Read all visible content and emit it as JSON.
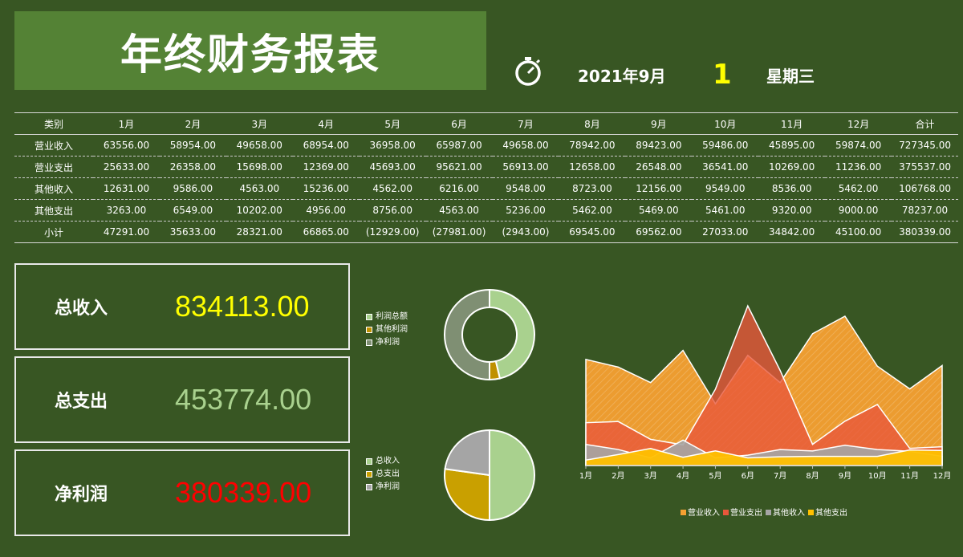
{
  "header": {
    "title": "年终财务报表",
    "date": "2021年9月",
    "day": "1",
    "weekday": "星期三"
  },
  "table": {
    "columns": [
      "类别",
      "1月",
      "2月",
      "3月",
      "4月",
      "5月",
      "6月",
      "7月",
      "8月",
      "9月",
      "10月",
      "11月",
      "12月",
      "合计"
    ],
    "rows": [
      {
        "label": "营业收入",
        "values": [
          "63556.00",
          "58954.00",
          "49658.00",
          "68954.00",
          "36958.00",
          "65987.00",
          "49658.00",
          "78942.00",
          "89423.00",
          "59486.00",
          "45895.00",
          "59874.00",
          "727345.00"
        ]
      },
      {
        "label": "营业支出",
        "values": [
          "25633.00",
          "26358.00",
          "15698.00",
          "12369.00",
          "45693.00",
          "95621.00",
          "56913.00",
          "12658.00",
          "26548.00",
          "36541.00",
          "10269.00",
          "11236.00",
          "375537.00"
        ]
      },
      {
        "label": "其他收入",
        "values": [
          "12631.00",
          "9586.00",
          "4563.00",
          "15236.00",
          "4562.00",
          "6216.00",
          "9548.00",
          "8723.00",
          "12156.00",
          "9549.00",
          "8536.00",
          "5462.00",
          "106768.00"
        ]
      },
      {
        "label": "其他支出",
        "values": [
          "3263.00",
          "6549.00",
          "10202.00",
          "4956.00",
          "8756.00",
          "4563.00",
          "5236.00",
          "5462.00",
          "5469.00",
          "5461.00",
          "9320.00",
          "9000.00",
          "78237.00"
        ]
      },
      {
        "label": "小计",
        "values": [
          "47291.00",
          "35633.00",
          "28321.00",
          "66865.00",
          "(12929.00)",
          "(27981.00)",
          "(2943.00)",
          "69545.00",
          "69562.00",
          "27033.00",
          "34842.00",
          "45100.00",
          "380339.00"
        ]
      }
    ]
  },
  "kpis": [
    {
      "label": "总收入",
      "value": "834113.00",
      "color": "#ffff00"
    },
    {
      "label": "总支出",
      "value": "453774.00",
      "color": "#a9d18e"
    },
    {
      "label": "净利润",
      "value": "380339.00",
      "color": "#ff0000"
    }
  ],
  "chart_data": [
    {
      "type": "pie",
      "variant": "donut",
      "labels": [
        "利润总额",
        "其他利润",
        "净利润"
      ],
      "values": [
        352234,
        28105,
        380339
      ],
      "colors": [
        "#a9d18e",
        "#bf9000",
        "#7f8f73"
      ]
    },
    {
      "type": "pie",
      "labels": [
        "总收入",
        "总支出",
        "净利润"
      ],
      "values": [
        834113,
        453774,
        380339
      ],
      "colors": [
        "#a9d18e",
        "#c9a000",
        "#a5a5a5"
      ]
    },
    {
      "type": "area",
      "categories": [
        "1月",
        "2月",
        "3月",
        "4月",
        "5月",
        "6月",
        "7月",
        "8月",
        "9月",
        "10月",
        "11月",
        "12月"
      ],
      "series": [
        {
          "name": "营业收入",
          "values": [
            63556,
            58954,
            49658,
            68954,
            36958,
            65987,
            49658,
            78942,
            89423,
            59486,
            45895,
            59874
          ],
          "color": "#f5a031"
        },
        {
          "name": "营业支出",
          "values": [
            25633,
            26358,
            15698,
            12369,
            45693,
            95621,
            56913,
            12658,
            26548,
            36541,
            10269,
            11236
          ],
          "color": "#e8573b"
        },
        {
          "name": "其他收入",
          "values": [
            12631,
            9586,
            4563,
            15236,
            4562,
            6216,
            9548,
            8723,
            12156,
            9549,
            8536,
            5462
          ],
          "color": "#a5a5a5"
        },
        {
          "name": "其他支出",
          "values": [
            3263,
            6549,
            10202,
            4956,
            8756,
            4563,
            5236,
            5462,
            5469,
            5461,
            9320,
            9000
          ],
          "color": "#ffc000"
        }
      ],
      "ylim": [
        0,
        100000
      ],
      "legend": "bottom"
    }
  ]
}
